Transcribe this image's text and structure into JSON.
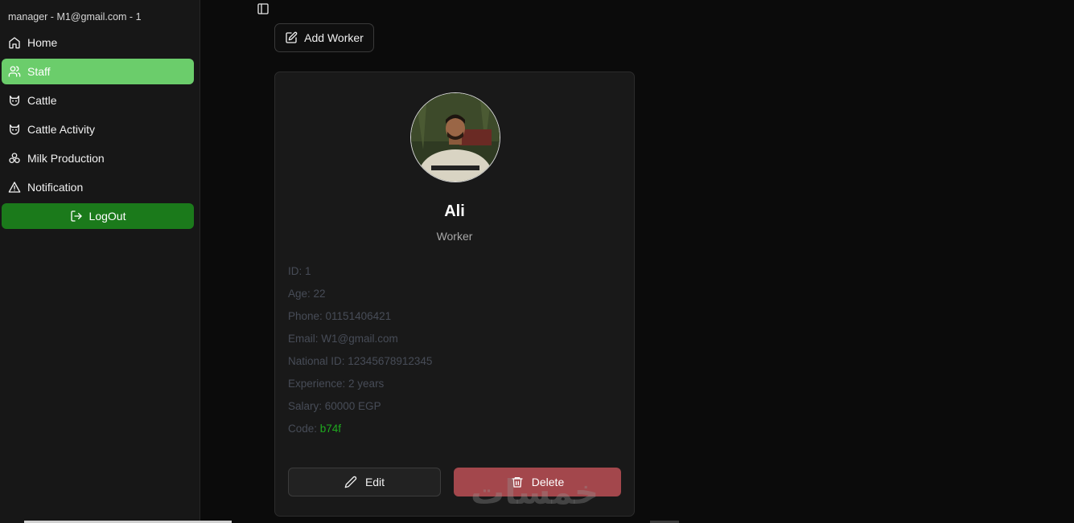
{
  "sidebar": {
    "account": "manager - M1@gmail.com - 1",
    "items": [
      {
        "label": "Home",
        "icon": "home-icon"
      },
      {
        "label": "Staff",
        "icon": "users-icon"
      },
      {
        "label": "Cattle",
        "icon": "cat-icon"
      },
      {
        "label": "Cattle Activity",
        "icon": "cat-icon"
      },
      {
        "label": "Milk Production",
        "icon": "milk-icon"
      },
      {
        "label": "Notification",
        "icon": "warning-icon"
      }
    ],
    "logout_label": "LogOut",
    "active_color": "#6bcd6b",
    "logout_color": "#1b7a1b"
  },
  "toolbar": {
    "add_worker_label": "Add Worker"
  },
  "worker": {
    "name": "Ali",
    "role": "Worker",
    "details": [
      "ID: 1",
      "Age: 22",
      "Phone: 01151406421",
      "Email: W1@gmail.com",
      "National ID: 12345678912345",
      "Experience: 2 years",
      "Salary: 60000 EGP"
    ],
    "code_label": "Code: ",
    "code_value": "b74f",
    "edit_label": "Edit",
    "delete_label": "Delete",
    "code_color": "#1faa1f",
    "delete_color": "#a3474c"
  },
  "watermark": "خمسات"
}
